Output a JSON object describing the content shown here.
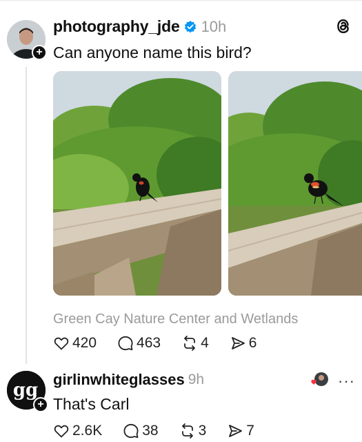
{
  "post": {
    "username": "photography_jde",
    "time": "10h",
    "text": "Can anyone name this bird?",
    "location": "Green Cay Nature Center and Wetlands",
    "likes": "420",
    "comments": "463",
    "reposts": "4",
    "shares": "6"
  },
  "reply": {
    "username": "girlinwhiteglasses",
    "time": "9h",
    "text": "That's Carl",
    "likes": "2.6K",
    "comments": "38",
    "reposts": "3",
    "shares": "7",
    "more": "···"
  },
  "avatar_badge": "+",
  "icons": {
    "verified": "verified-badge-icon",
    "threads": "threads-logo-icon",
    "like": "heart-icon",
    "comment": "comment-bubble-icon",
    "repost": "repost-icon",
    "share": "send-icon"
  },
  "colors": {
    "accent": "#0095f6",
    "muted": "#9a9a9a",
    "text": "#101010",
    "heart": "#ff3040"
  }
}
